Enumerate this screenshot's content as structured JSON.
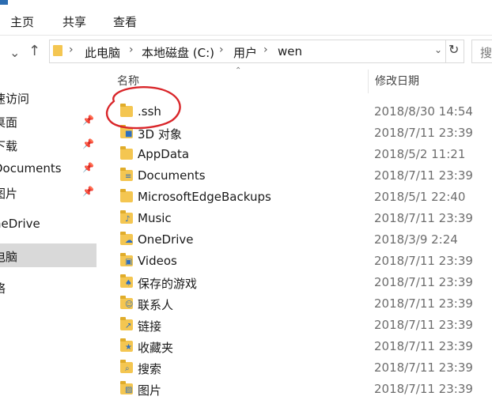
{
  "ribbon": {
    "tabs": [
      {
        "label": "主页"
      },
      {
        "label": "共享"
      },
      {
        "label": "查看"
      }
    ]
  },
  "address": {
    "crumbs": [
      "此电脑",
      "本地磁盘 (C:)",
      "用户",
      "wen"
    ],
    "search_placeholder": "搜"
  },
  "sidebar": {
    "items": [
      {
        "label": "速访问"
      },
      {
        "label": "桌面"
      },
      {
        "label": "下载"
      },
      {
        "label": "Documents"
      },
      {
        "label": "图片"
      },
      {
        "label": "neDrive"
      },
      {
        "label": "电脑"
      },
      {
        "label": "络"
      }
    ]
  },
  "columns": {
    "name": "名称",
    "date": "修改日期"
  },
  "files": [
    {
      "name": ".ssh",
      "date": "2018/8/30 14:54",
      "icon": "folder-icon"
    },
    {
      "name": "3D 对象",
      "date": "2018/7/11 23:39",
      "icon": "3d-objects-folder-icon"
    },
    {
      "name": "AppData",
      "date": "2018/5/2 11:21",
      "icon": "folder-icon"
    },
    {
      "name": "Documents",
      "date": "2018/7/11 23:39",
      "icon": "documents-folder-icon"
    },
    {
      "name": "MicrosoftEdgeBackups",
      "date": "2018/5/1 22:40",
      "icon": "folder-icon"
    },
    {
      "name": "Music",
      "date": "2018/7/11 23:39",
      "icon": "music-folder-icon"
    },
    {
      "name": "OneDrive",
      "date": "2018/3/9 2:24",
      "icon": "onedrive-folder-icon"
    },
    {
      "name": "Videos",
      "date": "2018/7/11 23:39",
      "icon": "videos-folder-icon"
    },
    {
      "name": "保存的游戏",
      "date": "2018/7/11 23:39",
      "icon": "saved-games-folder-icon"
    },
    {
      "name": "联系人",
      "date": "2018/7/11 23:39",
      "icon": "contacts-folder-icon"
    },
    {
      "name": "链接",
      "date": "2018/7/11 23:39",
      "icon": "links-folder-icon"
    },
    {
      "name": "收藏夹",
      "date": "2018/7/11 23:39",
      "icon": "favorites-folder-icon"
    },
    {
      "name": "搜索",
      "date": "2018/7/11 23:39",
      "icon": "searches-folder-icon"
    },
    {
      "name": "图片",
      "date": "2018/7/11 23:39",
      "icon": "pictures-folder-icon"
    }
  ],
  "colors": {
    "folder": "#f4c651",
    "selected_nav": "#d9d9d9",
    "annotation": "#d9262a"
  }
}
